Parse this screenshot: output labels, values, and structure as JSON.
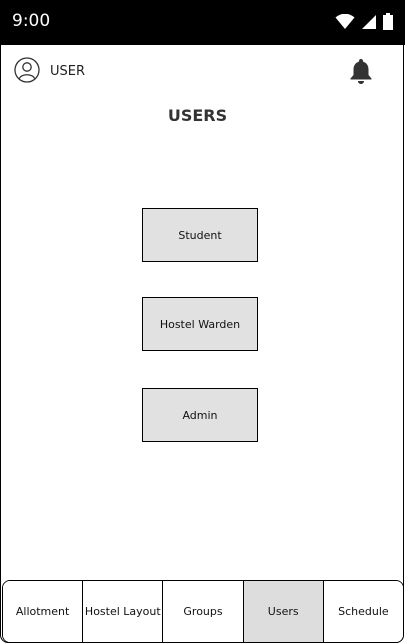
{
  "status_bar": {
    "time": "9:00",
    "icons": [
      "wifi-icon",
      "signal-icon",
      "battery-icon"
    ]
  },
  "header": {
    "user_label": "USER",
    "avatar_icon": "user-avatar-icon",
    "notification_icon": "bell-icon"
  },
  "main": {
    "title": "USERS",
    "buttons": [
      {
        "label": "Student"
      },
      {
        "label": "Hostel Warden"
      },
      {
        "label": "Admin"
      }
    ]
  },
  "bottom_nav": {
    "tabs": [
      {
        "label": "Allotment",
        "active": false
      },
      {
        "label": "Hostel Layout",
        "active": false
      },
      {
        "label": "Groups",
        "active": false
      },
      {
        "label": "Users",
        "active": true
      },
      {
        "label": "Schedule",
        "active": false
      }
    ]
  },
  "colors": {
    "status_bar_bg": "#000000",
    "button_bg": "#e1e1e1",
    "active_tab_bg": "#dddddd"
  }
}
